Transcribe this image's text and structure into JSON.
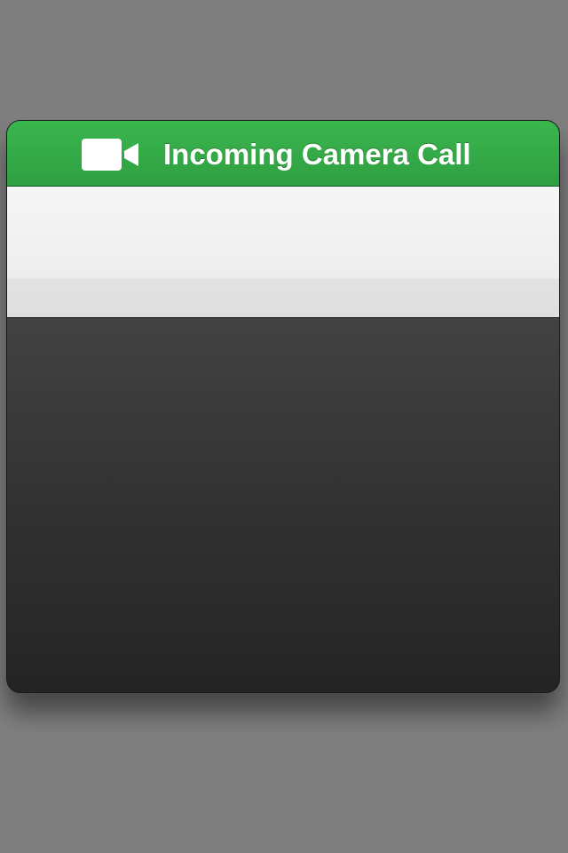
{
  "call": {
    "title": "Incoming Camera Call",
    "header_icon": "video-camera-icon",
    "accent_color": "#35ae49",
    "background_color": "#7f7f7f"
  }
}
